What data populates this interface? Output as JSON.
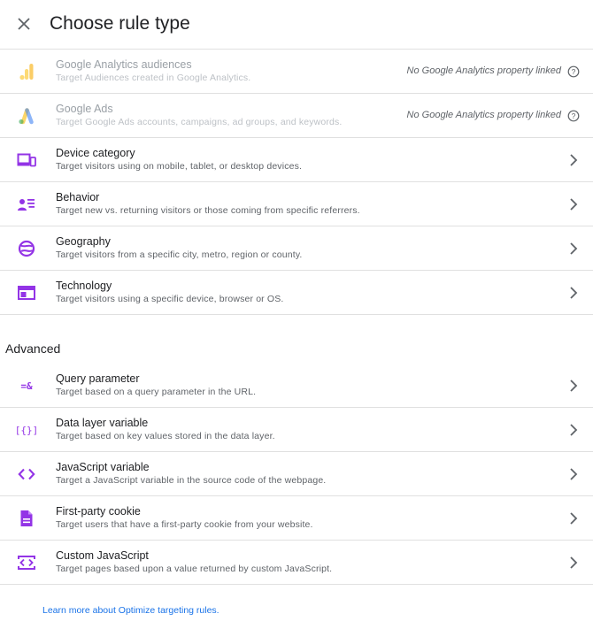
{
  "header": {
    "title": "Choose rule type",
    "close_icon": "close-icon"
  },
  "basic_rules": [
    {
      "title": "Google Analytics audiences",
      "description": "Target Audiences created in Google Analytics.",
      "status": "No Google Analytics property linked",
      "icon": "analytics-logo-icon",
      "disabled": true
    },
    {
      "title": "Google Ads",
      "description": "Target Google Ads accounts, campaigns, ad groups, and keywords.",
      "status": "No Google Analytics property linked",
      "icon": "google-ads-logo-icon",
      "disabled": true
    },
    {
      "title": "Device category",
      "description": "Target visitors using on mobile, tablet, or desktop devices.",
      "icon": "devices-icon"
    },
    {
      "title": "Behavior",
      "description": "Target new vs. returning visitors or those coming from specific referrers.",
      "icon": "person-list-icon"
    },
    {
      "title": "Geography",
      "description": "Target visitors from a specific city, metro, region or county.",
      "icon": "globe-icon"
    },
    {
      "title": "Technology",
      "description": "Target visitors using a specific device, browser or OS.",
      "icon": "web-window-icon"
    }
  ],
  "advanced": {
    "heading": "Advanced",
    "rules": [
      {
        "title": "Query parameter",
        "description": "Target based on a query parameter in the URL.",
        "icon": "query-parameter-icon",
        "glyph": "=&"
      },
      {
        "title": "Data layer variable",
        "description": "Target based on key values stored in the data layer.",
        "icon": "data-layer-icon",
        "glyph": "[{}]"
      },
      {
        "title": "JavaScript variable",
        "description": "Target a JavaScript variable in the source code of the webpage.",
        "icon": "code-icon"
      },
      {
        "title": "First-party cookie",
        "description": "Target users that have a first-party cookie from your website.",
        "icon": "document-icon"
      },
      {
        "title": "Custom JavaScript",
        "description": "Target pages based upon a value returned by custom JavaScript.",
        "icon": "custom-code-icon"
      }
    ]
  },
  "footer": {
    "learn_more": "Learn more about Optimize targeting rules."
  },
  "colors": {
    "accent": "#9334e6",
    "link": "#1a73e8",
    "divider": "#e0e0e0"
  }
}
